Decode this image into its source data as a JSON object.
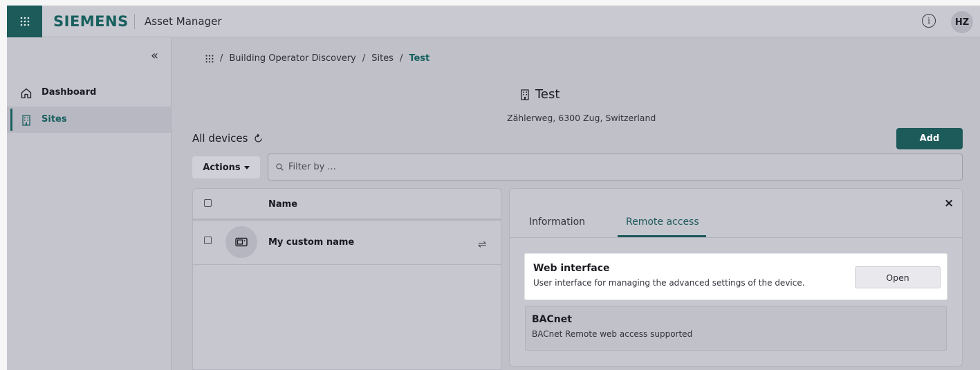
{
  "header": {
    "brand": "SIEMENS",
    "app_name": "Asset Manager",
    "info_glyph": "i",
    "user_initials": "HZ",
    "launcher_icon": "grid-launcher-icon"
  },
  "sidebar": {
    "collapse_glyph": "«",
    "items": [
      {
        "label": "Dashboard",
        "icon": "home-icon",
        "active": false
      },
      {
        "label": "Sites",
        "icon": "building-icon",
        "active": true
      }
    ]
  },
  "breadcrumb": {
    "separator": "/",
    "items": [
      "Building Operator Discovery",
      "Sites"
    ],
    "current": "Test"
  },
  "site": {
    "title": "Test",
    "address": "Zählerweg, 6300 Zug, Switzerland"
  },
  "devices": {
    "heading": "All devices",
    "add_label": "Add",
    "actions_label": "Actions",
    "filter_placeholder": "Filter by ...",
    "column_name": "Name",
    "rows": [
      {
        "name": "My custom name"
      }
    ]
  },
  "detail": {
    "close_glyph": "×",
    "tabs": [
      {
        "label": "Information",
        "active": false
      },
      {
        "label": "Remote access",
        "active": true
      }
    ],
    "access": [
      {
        "title": "Web interface",
        "description": "User interface for managing the advanced settings of the device.",
        "button_label": "Open"
      },
      {
        "title": "BACnet",
        "description": "BACnet Remote web access supported"
      }
    ]
  },
  "colors": {
    "accent": "#1d5a5a",
    "accent_text": "#17605e",
    "overlay_bg": "#c0c0c9"
  }
}
